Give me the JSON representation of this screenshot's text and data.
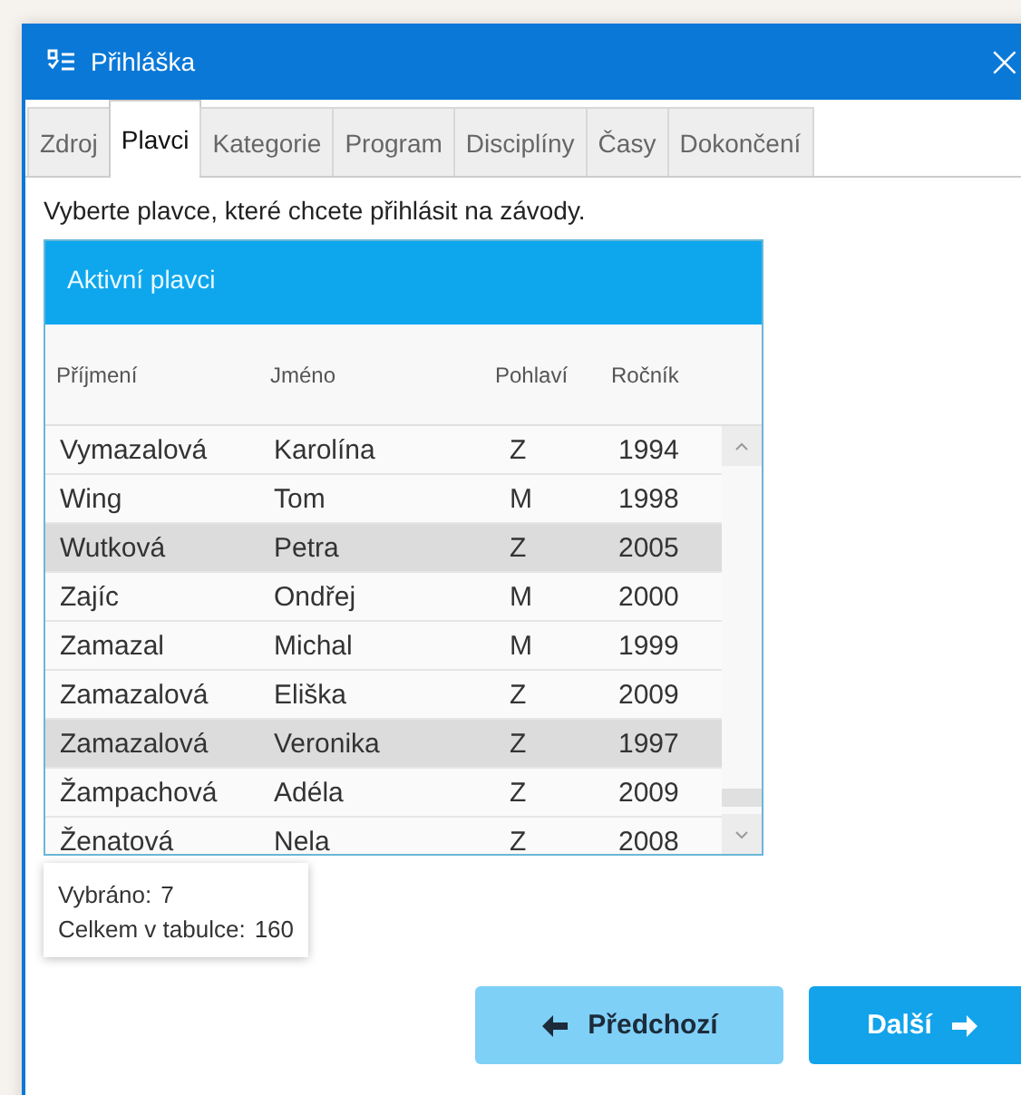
{
  "window": {
    "title": "Přihláška",
    "close": "×"
  },
  "tabs": [
    {
      "label": "Zdroj",
      "selected": false
    },
    {
      "label": "Plavci",
      "selected": true
    },
    {
      "label": "Kategorie",
      "selected": false
    },
    {
      "label": "Program",
      "selected": false
    },
    {
      "label": "Disciplíny",
      "selected": false
    },
    {
      "label": "Časy",
      "selected": false
    },
    {
      "label": "Dokončení",
      "selected": false
    }
  ],
  "instruction": "Vyberte plavce, které chcete přihlásit na závody.",
  "table": {
    "title": "Aktivní plavci",
    "columns": [
      "Příjmení",
      "Jméno",
      "Pohlaví",
      "Ročník"
    ],
    "rows": [
      {
        "cells": [
          "Vymazalová",
          "Karolína",
          "Z",
          "1994"
        ],
        "selected": false
      },
      {
        "cells": [
          "Wing",
          "Tom",
          "M",
          "1998"
        ],
        "selected": false
      },
      {
        "cells": [
          "Wutková",
          "Petra",
          "Z",
          "2005"
        ],
        "selected": true
      },
      {
        "cells": [
          "Zajíc",
          "Ondřej",
          "M",
          "2000"
        ],
        "selected": false
      },
      {
        "cells": [
          "Zamazal",
          "Michal",
          "M",
          "1999"
        ],
        "selected": false
      },
      {
        "cells": [
          "Zamazalová",
          "Eliška",
          "Z",
          "2009"
        ],
        "selected": false
      },
      {
        "cells": [
          "Zamazalová",
          "Veronika",
          "Z",
          "1997"
        ],
        "selected": true
      },
      {
        "cells": [
          "Žampachová",
          "Adéla",
          "Z",
          "2009"
        ],
        "selected": false
      },
      {
        "cells": [
          "Ženatová",
          "Nela",
          "Z",
          "2008"
        ],
        "selected": false
      }
    ]
  },
  "summary": [
    {
      "label": "Vybráno:",
      "value": "7"
    },
    {
      "label": "Celkem v tabulce:",
      "value": "160"
    }
  ],
  "buttons": [
    {
      "label": "Předchozí",
      "kind": "back"
    },
    {
      "label": "Další",
      "kind": "next"
    }
  ]
}
